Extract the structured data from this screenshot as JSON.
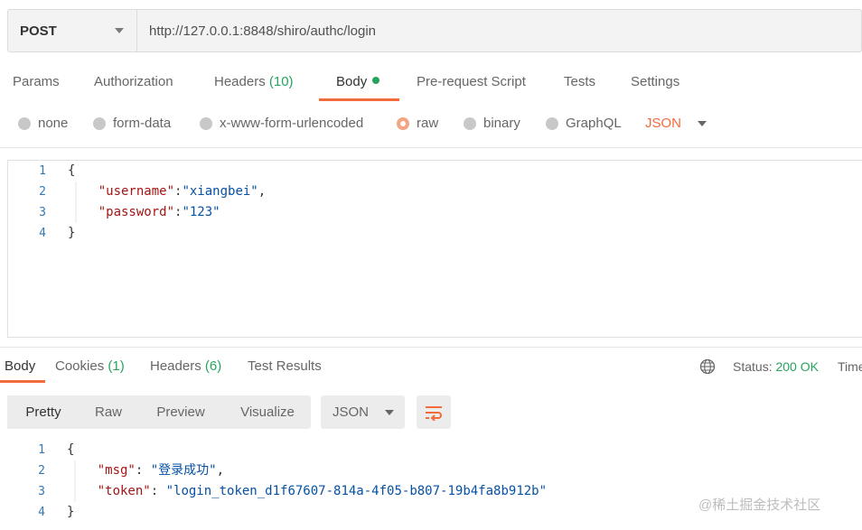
{
  "request": {
    "method": "POST",
    "url": "http://127.0.0.1:8848/shiro/authc/login"
  },
  "request_tabs": [
    {
      "label": "Params"
    },
    {
      "label": "Authorization"
    },
    {
      "label": "Headers",
      "count": "(10)"
    },
    {
      "label": "Body",
      "active": true
    },
    {
      "label": "Pre-request Script"
    },
    {
      "label": "Tests"
    },
    {
      "label": "Settings"
    }
  ],
  "body_types": [
    "none",
    "form-data",
    "x-www-form-urlencoded",
    "raw",
    "binary",
    "GraphQL"
  ],
  "body_type_selected": "raw",
  "body_language": "JSON",
  "request_body": {
    "line_numbers": [
      "1",
      "2",
      "3",
      "4"
    ],
    "lines": [
      {
        "parts": [
          {
            "t": "{",
            "c": "punct"
          }
        ]
      },
      {
        "indent": "    ",
        "parts": [
          {
            "t": "\"username\"",
            "c": "key"
          },
          {
            "t": ":",
            "c": "punct"
          },
          {
            "t": "\"xiangbei\"",
            "c": "str"
          },
          {
            "t": ",",
            "c": "punct"
          }
        ]
      },
      {
        "indent": "    ",
        "parts": [
          {
            "t": "\"password\"",
            "c": "key"
          },
          {
            "t": ":",
            "c": "punct"
          },
          {
            "t": "\"123\"",
            "c": "str"
          }
        ]
      },
      {
        "parts": [
          {
            "t": "}",
            "c": "punct"
          }
        ]
      }
    ]
  },
  "response_tabs": [
    {
      "label": "Body",
      "active": true
    },
    {
      "label": "Cookies",
      "count": "(1)"
    },
    {
      "label": "Headers",
      "count": "(6)"
    },
    {
      "label": "Test Results"
    }
  ],
  "status": {
    "label": "Status:",
    "value": "200 OK",
    "time_label": "Time"
  },
  "view_modes": [
    "Pretty",
    "Raw",
    "Preview",
    "Visualize"
  ],
  "view_mode_active": "Pretty",
  "response_format": "JSON",
  "response_body": {
    "line_numbers": [
      "1",
      "2",
      "3",
      "4"
    ],
    "lines": [
      {
        "parts": [
          {
            "t": "{",
            "c": "punct"
          }
        ]
      },
      {
        "indent": "    ",
        "parts": [
          {
            "t": "\"msg\"",
            "c": "key"
          },
          {
            "t": ": ",
            "c": "punct"
          },
          {
            "t": "\"登录成功\"",
            "c": "str"
          },
          {
            "t": ",",
            "c": "punct"
          }
        ]
      },
      {
        "indent": "    ",
        "parts": [
          {
            "t": "\"token\"",
            "c": "key"
          },
          {
            "t": ": ",
            "c": "punct"
          },
          {
            "t": "\"login_token_d1f67607-814a-4f05-b807-19b4fa8b912b\"",
            "c": "str"
          }
        ]
      },
      {
        "parts": [
          {
            "t": "}",
            "c": "punct"
          }
        ]
      }
    ]
  },
  "watermark": "@稀土掘金技术社区",
  "colors": {
    "accent": "#f26b3a",
    "success": "#26a45d",
    "json_key": "#a31515",
    "json_string": "#0451a5",
    "line_number": "#3577b2"
  }
}
